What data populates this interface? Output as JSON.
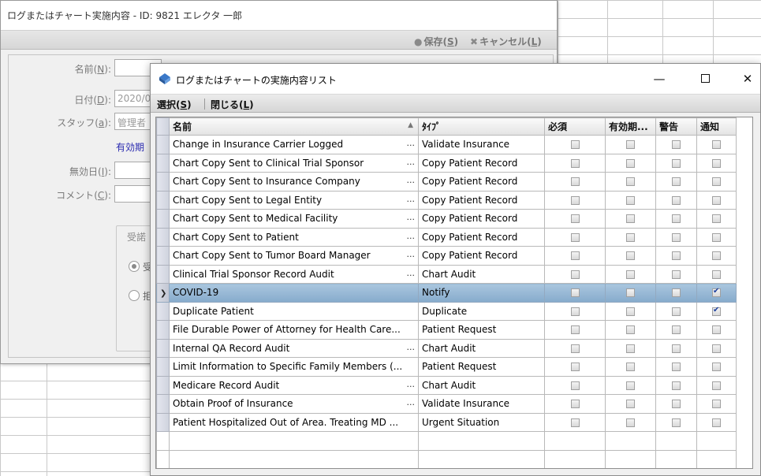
{
  "back_window": {
    "title": "ログまたはチャート実施内容 - ID: 9821  エレクタ 一郎",
    "toolbar": {
      "save_label": "保存",
      "save_key": "S",
      "cancel_label": "キャンセル",
      "cancel_key": "L"
    },
    "form": {
      "name_label": "名前",
      "name_key": "N",
      "date_label": "日付",
      "date_key": "D",
      "date_value": "2020/0",
      "staff_label": "スタッフ",
      "staff_key": "a",
      "staff_value": "管理者",
      "expiry_link": "有効期",
      "invalid_date_label": "無効日",
      "invalid_date_key": "I",
      "comment_label": "コメント",
      "comment_key": "C",
      "group_title": "受諾",
      "radio1": "受",
      "radio2": "拒"
    }
  },
  "dialog": {
    "title": "ログまたはチャートの実施内容リスト",
    "menu": {
      "select_label": "選択",
      "select_key": "S",
      "close_label": "閉じる",
      "close_key": "L"
    },
    "columns": {
      "name": "名前",
      "type": "ﾀｲﾌﾟ",
      "required": "必須",
      "expiry": "有効期...",
      "warning": "警告",
      "notify": "通知"
    },
    "rows": [
      {
        "name": "Change in Insurance Carrier Logged",
        "type": "Validate Insurance",
        "notify": false
      },
      {
        "name": "Chart Copy Sent to Clinical Trial Sponsor",
        "type": "Copy Patient Record",
        "notify": false
      },
      {
        "name": "Chart Copy Sent to Insurance Company",
        "type": "Copy Patient Record",
        "notify": false
      },
      {
        "name": "Chart Copy Sent to Legal Entity",
        "type": "Copy Patient Record",
        "notify": false
      },
      {
        "name": "Chart Copy Sent to Medical Facility",
        "type": "Copy Patient Record",
        "notify": false
      },
      {
        "name": "Chart Copy Sent to Patient",
        "type": "Copy Patient Record",
        "notify": false
      },
      {
        "name": "Chart Copy Sent to Tumor Board Manager",
        "type": "Copy Patient Record",
        "notify": false
      },
      {
        "name": "Clinical Trial Sponsor Record Audit",
        "type": "Chart Audit",
        "notify": false
      },
      {
        "name": "COVID-19",
        "type": "Notify",
        "notify": true,
        "selected": true
      },
      {
        "name": "Duplicate Patient",
        "type": "Duplicate",
        "notify": true
      },
      {
        "name": "File Durable Power of Attorney for Health Care...",
        "type": "Patient Request",
        "notify": false
      },
      {
        "name": "Internal QA Record Audit",
        "type": "Chart Audit",
        "notify": false
      },
      {
        "name": "Limit Information to Specific Family Members (...",
        "type": "Patient Request",
        "notify": false
      },
      {
        "name": "Medicare Record Audit",
        "type": "Chart Audit",
        "notify": false
      },
      {
        "name": "Obtain Proof of Insurance",
        "type": "Validate Insurance",
        "notify": false
      },
      {
        "name": "Patient Hospitalized Out of Area. Treating MD ...",
        "type": "Urgent Situation",
        "notify": false
      }
    ],
    "ellipsis_rows": [
      0,
      1,
      2,
      3,
      4,
      5,
      6,
      7,
      11,
      13,
      14
    ]
  },
  "colors": {
    "selected_row": "#94b6d4",
    "header_bg": "#e3e3e3",
    "link_blue": "#2a2ab0"
  }
}
